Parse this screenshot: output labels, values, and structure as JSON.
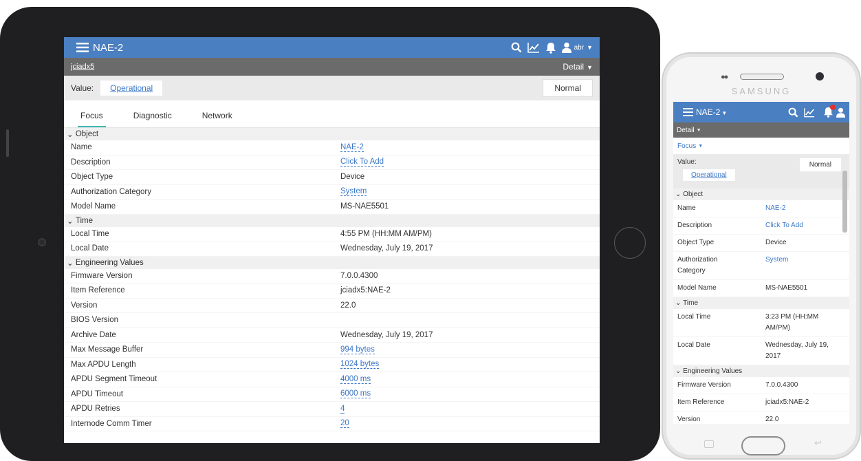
{
  "tablet": {
    "title": "NAE-2",
    "user_name": "abr",
    "breadcrumb": "jciadx5",
    "view_label": "Detail",
    "value_label": "Value:",
    "value": "Operational",
    "status": "Normal",
    "tabs": [
      {
        "label": "Focus",
        "active": true
      },
      {
        "label": "Diagnostic",
        "active": false
      },
      {
        "label": "Network",
        "active": false
      }
    ],
    "sections": {
      "object": "Object",
      "time": "Time",
      "engineering": "Engineering Values"
    },
    "rows": {
      "name": {
        "label": "Name",
        "value": "NAE-2"
      },
      "description": {
        "label": "Description",
        "value": "Click To Add"
      },
      "object_type": {
        "label": "Object Type",
        "value": "Device"
      },
      "auth_category": {
        "label": "Authorization Category",
        "value": "System"
      },
      "model_name": {
        "label": "Model Name",
        "value": "MS-NAE5501"
      },
      "local_time": {
        "label": "Local Time",
        "value": "4:55 PM (HH:MM AM/PM)"
      },
      "local_date": {
        "label": "Local Date",
        "value": "Wednesday, July 19, 2017"
      },
      "firmware": {
        "label": "Firmware Version",
        "value": "7.0.0.4300"
      },
      "item_ref": {
        "label": "Item Reference",
        "value": "jciadx5:NAE-2"
      },
      "version": {
        "label": "Version",
        "value": "22.0"
      },
      "bios": {
        "label": "BIOS Version",
        "value": ""
      },
      "archive_date": {
        "label": "Archive Date",
        "value": "Wednesday, July 19, 2017"
      },
      "max_msg": {
        "label": "Max Message Buffer",
        "value": "994 bytes"
      },
      "max_apdu": {
        "label": "Max APDU Length",
        "value": "1024 bytes"
      },
      "apdu_seg": {
        "label": "APDU Segment Timeout",
        "value": "4000 ms"
      },
      "apdu_timeout": {
        "label": "APDU Timeout",
        "value": "6000 ms"
      },
      "apdu_retries": {
        "label": "APDU Retries",
        "value": "4"
      },
      "internode": {
        "label": "Internode Comm Timer",
        "value": "20"
      }
    }
  },
  "phone": {
    "brand": "SAMSUNG",
    "title": "NAE-2",
    "view_label": "Detail",
    "tab_label": "Focus",
    "value_label": "Value:",
    "value": "Operational",
    "status": "Normal",
    "sections": {
      "object": "Object",
      "time": "Time",
      "engineering": "Engineering Values"
    },
    "rows": {
      "name": {
        "label": "Name",
        "value": "NAE-2"
      },
      "description": {
        "label": "Description",
        "value": "Click To Add"
      },
      "object_type": {
        "label": "Object Type",
        "value": "Device"
      },
      "auth_category": {
        "label": "Authorization Category",
        "value": "System"
      },
      "model_name": {
        "label": "Model Name",
        "value": "MS-NAE5501"
      },
      "local_time": {
        "label": "Local Time",
        "value": "3:23 PM (HH:MM AM/PM)"
      },
      "local_date": {
        "label": "Local Date",
        "value": "Wednesday, July 19, 2017"
      },
      "firmware": {
        "label": "Firmware Version",
        "value": "7.0.0.4300"
      },
      "item_ref": {
        "label": "Item Reference",
        "value": "jciadx5:NAE-2"
      },
      "version": {
        "label": "Version",
        "value": "22.0"
      }
    }
  },
  "colors": {
    "header_blue": "#4a7fc1",
    "subheader_gray": "#6b6b6b",
    "link_blue": "#3d78c8",
    "tab_underline": "#3cb8b0",
    "badge_red": "#e03030"
  },
  "icons": [
    "hamburger-icon",
    "search-icon",
    "trend-icon",
    "bell-icon",
    "user-icon",
    "chevron-down-icon"
  ]
}
